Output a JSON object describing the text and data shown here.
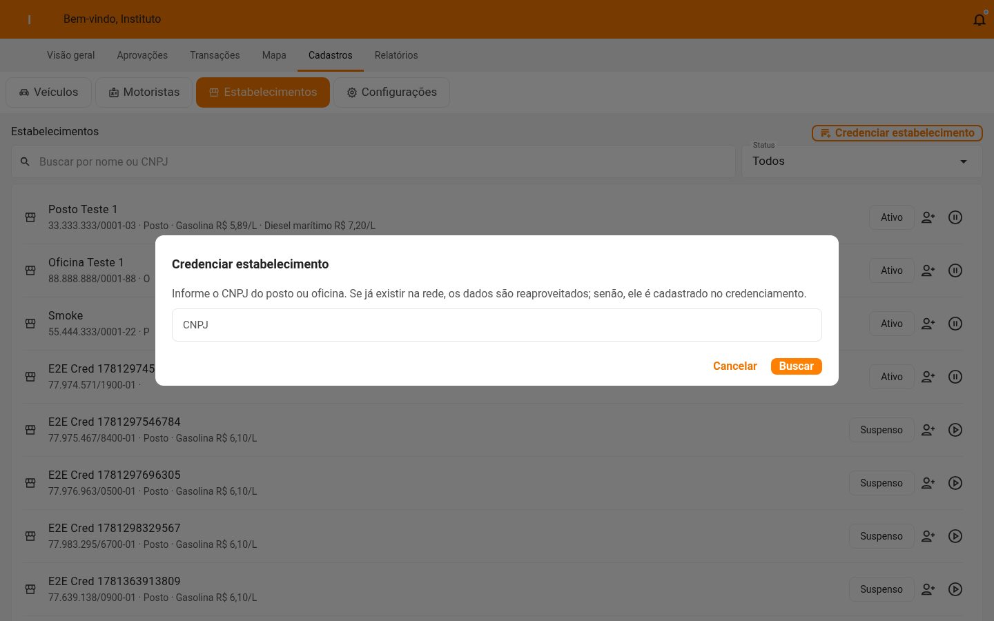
{
  "header": {
    "logo": "I",
    "greeting": "Bem-vindo, Instituto",
    "notification_dot": true
  },
  "nav": [
    {
      "label": "Visão geral",
      "selected": false
    },
    {
      "label": "Aprovações",
      "selected": false
    },
    {
      "label": "Transações",
      "selected": false
    },
    {
      "label": "Mapa",
      "selected": false
    },
    {
      "label": "Cadastros",
      "selected": true
    },
    {
      "label": "Relatórios",
      "selected": false
    }
  ],
  "subtabs": [
    {
      "label": "Veículos",
      "selected": false
    },
    {
      "label": "Motoristas",
      "selected": false
    },
    {
      "label": "Estabelecimentos",
      "selected": true
    },
    {
      "label": "Configurações",
      "selected": false
    }
  ],
  "section": {
    "title": "Estabelecimentos",
    "action": "Credenciar estabelecimento"
  },
  "search": {
    "placeholder": "Buscar por nome ou CNPJ"
  },
  "status_filter": {
    "label": "Status",
    "value": "Todos"
  },
  "rows": [
    {
      "name": "Posto Teste 1",
      "details": "33.333.333/0001-03 · Posto · Gasolina R$ 5,89/L · Diesel marítimo R$ 7,20/L",
      "status": "Ativo",
      "suspended": false
    },
    {
      "name": "Oficina Teste 1",
      "details": "88.888.888/0001-88 · O",
      "status": "Ativo",
      "suspended": false
    },
    {
      "name": "Smoke",
      "details": "55.444.333/0001-22 · P",
      "status": "Ativo",
      "suspended": false
    },
    {
      "name": "E2E Cred 178129745",
      "details": "77.974.571/1900-01 ·",
      "status": "Ativo",
      "suspended": false
    },
    {
      "name": "E2E Cred 1781297546784",
      "details": "77.975.467/8400-01 · Posto · Gasolina R$ 6,10/L",
      "status": "Suspenso",
      "suspended": true
    },
    {
      "name": "E2E Cred 1781297696305",
      "details": "77.976.963/0500-01 · Posto · Gasolina R$ 6,10/L",
      "status": "Suspenso",
      "suspended": true
    },
    {
      "name": "E2E Cred 1781298329567",
      "details": "77.983.295/6700-01 · Posto · Gasolina R$ 6,10/L",
      "status": "Suspenso",
      "suspended": true
    },
    {
      "name": "E2E Cred 1781363913809",
      "details": "77.639.138/0900-01 · Posto · Gasolina R$ 6,10/L",
      "status": "Suspenso",
      "suspended": true
    }
  ],
  "dialog": {
    "title": "Credenciar estabelecimento",
    "text": "Informe o CNPJ do posto ou oficina. Se já existir na rede, os dados são reaproveitados; senão, ele é cadastrado no credenciamento.",
    "field_placeholder": "CNPJ",
    "buttons": [
      "Cancelar",
      "Buscar"
    ]
  }
}
